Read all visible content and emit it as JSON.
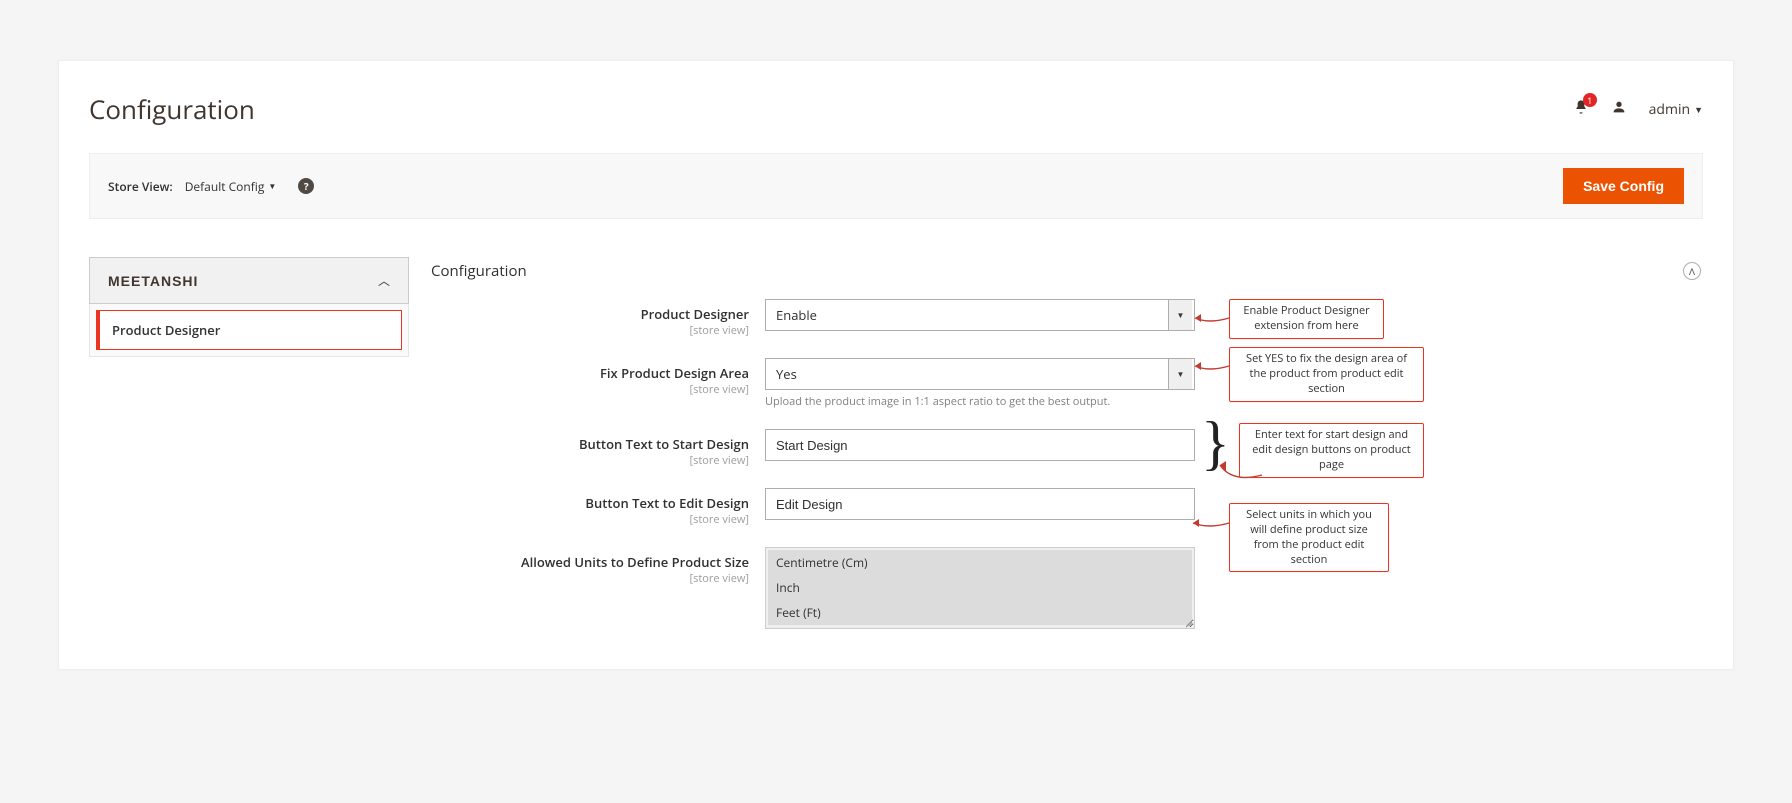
{
  "header": {
    "title": "Configuration",
    "notifications": "1",
    "user_label": "admin"
  },
  "toolbar": {
    "store_view_label": "Store View:",
    "store_view_value": "Default Config",
    "save_label": "Save Config"
  },
  "sidebar": {
    "brand": "MEETANSHI",
    "item": "Product Designer"
  },
  "section": {
    "title": "Configuration"
  },
  "fields": {
    "scope": "[store view]",
    "product_designer": {
      "label": "Product Designer",
      "value": "Enable"
    },
    "fix_area": {
      "label": "Fix Product Design Area",
      "value": "Yes",
      "hint": "Upload the product image in 1:1 aspect ratio to get the best output."
    },
    "btn_start": {
      "label": "Button Text to Start Design",
      "value": "Start Design"
    },
    "btn_edit": {
      "label": "Button Text to Edit Design",
      "value": "Edit Design"
    },
    "units": {
      "label": "Allowed Units to Define Product Size",
      "options": [
        "Centimetre (Cm)",
        "Inch",
        "Feet (Ft)"
      ]
    }
  },
  "callouts": {
    "c1": "Enable Product Designer extension from here",
    "c2": "Set YES to fix the design area of the product from product edit section",
    "c3": "Enter text for start design and edit design buttons on product page",
    "c4": "Select units in which you will define product size from the product edit section"
  }
}
